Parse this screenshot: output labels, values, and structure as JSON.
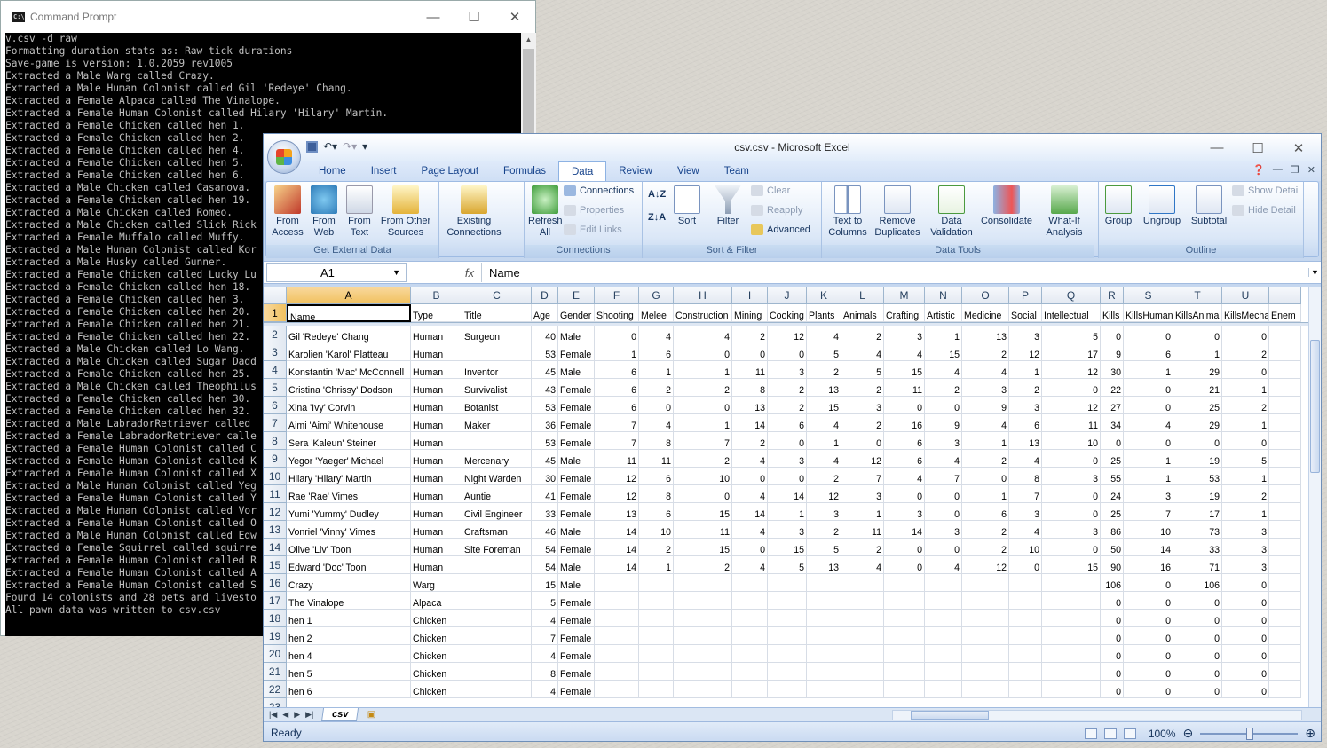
{
  "cmd": {
    "title": "Command Prompt",
    "icon": "cmd-icon",
    "lines": [
      "v.csv -d raw",
      "Formatting duration stats as: Raw tick durations",
      "Save-game is version: 1.0.2059 rev1005",
      "Extracted a Male Warg called Crazy.",
      "Extracted a Male Human Colonist called Gil 'Redeye' Chang.",
      "Extracted a Female Alpaca called The Vinalope.",
      "Extracted a Female Human Colonist called Hilary 'Hilary' Martin.",
      "Extracted a Female Chicken called hen 1.",
      "Extracted a Female Chicken called hen 2.",
      "Extracted a Female Chicken called hen 4.",
      "Extracted a Female Chicken called hen 5.",
      "Extracted a Female Chicken called hen 6.",
      "Extracted a Male Chicken called Casanova.",
      "Extracted a Female Chicken called hen 19.",
      "Extracted a Male Chicken called Romeo.",
      "Extracted a Male Chicken called Slick Rick",
      "Extracted a Female Muffalo called Muffy.",
      "Extracted a Male Human Colonist called Kor",
      "Extracted a Male Husky called Gunner.",
      "Extracted a Female Chicken called Lucky Lu",
      "Extracted a Female Chicken called hen 18.",
      "Extracted a Female Chicken called hen 3.",
      "Extracted a Female Chicken called hen 20.",
      "Extracted a Female Chicken called hen 21.",
      "Extracted a Female Chicken called hen 22.",
      "Extracted a Male Chicken called Lo Wang.",
      "Extracted a Male Chicken called Sugar Dadd",
      "Extracted a Female Chicken called hen 25.",
      "Extracted a Male Chicken called Theophilus",
      "Extracted a Female Chicken called hen 30.",
      "Extracted a Female Chicken called hen 32.",
      "Extracted a Male LabradorRetriever called",
      "Extracted a Female LabradorRetriever calle",
      "Extracted a Female Human Colonist called C",
      "Extracted a Female Human Colonist called K",
      "Extracted a Female Human Colonist called X",
      "Extracted a Male Human Colonist called Yeg",
      "Extracted a Female Human Colonist called Y",
      "Extracted a Male Human Colonist called Vor",
      "Extracted a Female Human Colonist called O",
      "Extracted a Male Human Colonist called Edw",
      "Extracted a Female Squirrel called squirre",
      "Extracted a Female Human Colonist called R",
      "Extracted a Female Human Colonist called A",
      "Extracted a Female Human Colonist called S",
      "Found 14 colonists and 28 pets and livesto",
      "All pawn data was written to csv.csv"
    ]
  },
  "excel": {
    "title": "csv.csv - Microsoft Excel",
    "tabs": [
      "Home",
      "Insert",
      "Page Layout",
      "Formulas",
      "Data",
      "Review",
      "View",
      "Team"
    ],
    "active_tab": "Data",
    "groups": {
      "get_external": {
        "label": "Get External Data",
        "buttons": [
          "From Access",
          "From Web",
          "From Text",
          "From Other Sources",
          "Existing Connections"
        ]
      },
      "connections": {
        "label": "Connections",
        "refresh": "Refresh All",
        "items": [
          "Connections",
          "Properties",
          "Edit Links"
        ]
      },
      "sort_filter": {
        "label": "Sort & Filter",
        "sort": "Sort",
        "filter": "Filter",
        "items": [
          "Clear",
          "Reapply",
          "Advanced"
        ]
      },
      "data_tools": {
        "label": "Data Tools",
        "buttons": [
          "Text to Columns",
          "Remove Duplicates",
          "Data Validation",
          "Consolidate",
          "What-If Analysis"
        ]
      },
      "outline": {
        "label": "Outline",
        "buttons": [
          "Group",
          "Ungroup",
          "Subtotal"
        ],
        "items": [
          "Show Detail",
          "Hide Detail"
        ]
      }
    },
    "name_box": "A1",
    "fx": "fx",
    "formula": "Name",
    "columns": [
      "A",
      "B",
      "C",
      "D",
      "E",
      "F",
      "G",
      "H",
      "I",
      "J",
      "K",
      "L",
      "M",
      "N",
      "O",
      "P",
      "Q",
      "R",
      "S",
      "T",
      "U",
      ""
    ],
    "headers": [
      "Name",
      "Type",
      "Title",
      "Age",
      "Gender",
      "Shooting",
      "Melee",
      "Construction",
      "Mining",
      "Cooking",
      "Plants",
      "Animals",
      "Crafting",
      "Artistic",
      "Medicine",
      "Social",
      "Intellectual",
      "Kills",
      "KillsHumanl",
      "KillsAnima",
      "KillsMecha",
      "Enem"
    ],
    "rows": [
      [
        "Gil 'Redeye' Chang",
        "Human",
        "Surgeon",
        "40",
        "Male",
        "0",
        "4",
        "4",
        "2",
        "12",
        "4",
        "2",
        "3",
        "1",
        "13",
        "3",
        "5",
        "0",
        "0",
        "0",
        "0",
        ""
      ],
      [
        "Karolien 'Karol' Platteau",
        "Human",
        "",
        "53",
        "Female",
        "1",
        "6",
        "0",
        "0",
        "0",
        "5",
        "4",
        "4",
        "15",
        "2",
        "12",
        "17",
        "9",
        "6",
        "1",
        "2",
        ""
      ],
      [
        "Konstantin 'Mac' McConnell",
        "Human",
        "Inventor",
        "45",
        "Male",
        "6",
        "1",
        "1",
        "11",
        "3",
        "2",
        "5",
        "15",
        "4",
        "4",
        "1",
        "12",
        "30",
        "1",
        "29",
        "0",
        ""
      ],
      [
        "Cristina 'Chrissy' Dodson",
        "Human",
        "Survivalist",
        "43",
        "Female",
        "6",
        "2",
        "2",
        "8",
        "2",
        "13",
        "2",
        "11",
        "2",
        "3",
        "2",
        "0",
        "22",
        "0",
        "21",
        "1",
        ""
      ],
      [
        "Xina 'Ivy' Corvin",
        "Human",
        "Botanist",
        "53",
        "Female",
        "6",
        "0",
        "0",
        "13",
        "2",
        "15",
        "3",
        "0",
        "0",
        "9",
        "3",
        "12",
        "27",
        "0",
        "25",
        "2",
        ""
      ],
      [
        "Aimi 'Aimi' Whitehouse",
        "Human",
        "Maker",
        "36",
        "Female",
        "7",
        "4",
        "1",
        "14",
        "6",
        "4",
        "2",
        "16",
        "9",
        "4",
        "6",
        "11",
        "34",
        "4",
        "29",
        "1",
        ""
      ],
      [
        "Sera 'Kaleun' Steiner",
        "Human",
        "",
        "53",
        "Female",
        "7",
        "8",
        "7",
        "2",
        "0",
        "1",
        "0",
        "6",
        "3",
        "1",
        "13",
        "10",
        "0",
        "0",
        "0",
        "0",
        ""
      ],
      [
        "Yegor 'Yaeger' Michael",
        "Human",
        "Mercenary",
        "45",
        "Male",
        "11",
        "11",
        "2",
        "4",
        "3",
        "4",
        "12",
        "6",
        "4",
        "2",
        "4",
        "0",
        "25",
        "1",
        "19",
        "5",
        ""
      ],
      [
        "Hilary 'Hilary' Martin",
        "Human",
        "Night Warden",
        "30",
        "Female",
        "12",
        "6",
        "10",
        "0",
        "0",
        "2",
        "7",
        "4",
        "7",
        "0",
        "8",
        "3",
        "55",
        "1",
        "53",
        "1",
        ""
      ],
      [
        "Rae 'Rae' Vimes",
        "Human",
        "Auntie",
        "41",
        "Female",
        "12",
        "8",
        "0",
        "4",
        "14",
        "12",
        "3",
        "0",
        "0",
        "1",
        "7",
        "0",
        "24",
        "3",
        "19",
        "2",
        ""
      ],
      [
        "Yumi 'Yummy' Dudley",
        "Human",
        "Civil Engineer",
        "33",
        "Female",
        "13",
        "6",
        "15",
        "14",
        "1",
        "3",
        "1",
        "3",
        "0",
        "6",
        "3",
        "0",
        "25",
        "7",
        "17",
        "1",
        ""
      ],
      [
        "Vonriel 'Vinny' Vimes",
        "Human",
        "Craftsman",
        "46",
        "Male",
        "14",
        "10",
        "11",
        "4",
        "3",
        "2",
        "11",
        "14",
        "3",
        "2",
        "4",
        "3",
        "86",
        "10",
        "73",
        "3",
        ""
      ],
      [
        "Olive 'Liv' Toon",
        "Human",
        "Site Foreman",
        "54",
        "Female",
        "14",
        "2",
        "15",
        "0",
        "15",
        "5",
        "2",
        "0",
        "0",
        "2",
        "10",
        "0",
        "50",
        "14",
        "33",
        "3",
        ""
      ],
      [
        "Edward 'Doc' Toon",
        "Human",
        "",
        "54",
        "Male",
        "14",
        "1",
        "2",
        "4",
        "5",
        "13",
        "4",
        "0",
        "4",
        "12",
        "0",
        "15",
        "90",
        "16",
        "71",
        "3",
        ""
      ],
      [
        "Crazy",
        "Warg",
        "",
        "15",
        "Male",
        "",
        "",
        "",
        "",
        "",
        "",
        "",
        "",
        "",
        "",
        "",
        "",
        "106",
        "0",
        "106",
        "0",
        ""
      ],
      [
        "The Vinalope",
        "Alpaca",
        "",
        "5",
        "Female",
        "",
        "",
        "",
        "",
        "",
        "",
        "",
        "",
        "",
        "",
        "",
        "",
        "0",
        "0",
        "0",
        "0",
        ""
      ],
      [
        "hen 1",
        "Chicken",
        "",
        "4",
        "Female",
        "",
        "",
        "",
        "",
        "",
        "",
        "",
        "",
        "",
        "",
        "",
        "",
        "0",
        "0",
        "0",
        "0",
        ""
      ],
      [
        "hen 2",
        "Chicken",
        "",
        "7",
        "Female",
        "",
        "",
        "",
        "",
        "",
        "",
        "",
        "",
        "",
        "",
        "",
        "",
        "0",
        "0",
        "0",
        "0",
        ""
      ],
      [
        "hen 4",
        "Chicken",
        "",
        "4",
        "Female",
        "",
        "",
        "",
        "",
        "",
        "",
        "",
        "",
        "",
        "",
        "",
        "",
        "0",
        "0",
        "0",
        "0",
        ""
      ],
      [
        "hen 5",
        "Chicken",
        "",
        "8",
        "Female",
        "",
        "",
        "",
        "",
        "",
        "",
        "",
        "",
        "",
        "",
        "",
        "",
        "0",
        "0",
        "0",
        "0",
        ""
      ],
      [
        "hen 6",
        "Chicken",
        "",
        "4",
        "Female",
        "",
        "",
        "",
        "",
        "",
        "",
        "",
        "",
        "",
        "",
        "",
        "",
        "0",
        "0",
        "0",
        "0",
        ""
      ]
    ],
    "row_numbers": [
      "1",
      "2",
      "3",
      "4",
      "5",
      "6",
      "7",
      "8",
      "9",
      "10",
      "11",
      "12",
      "13",
      "14",
      "15",
      "16",
      "17",
      "18",
      "19",
      "20",
      "21",
      "22",
      "23"
    ],
    "sheet_tab": "csv",
    "status": "Ready",
    "zoom": "100%",
    "colors": {
      "accent": "#15428b",
      "selected_header": "#f1c15f"
    }
  }
}
